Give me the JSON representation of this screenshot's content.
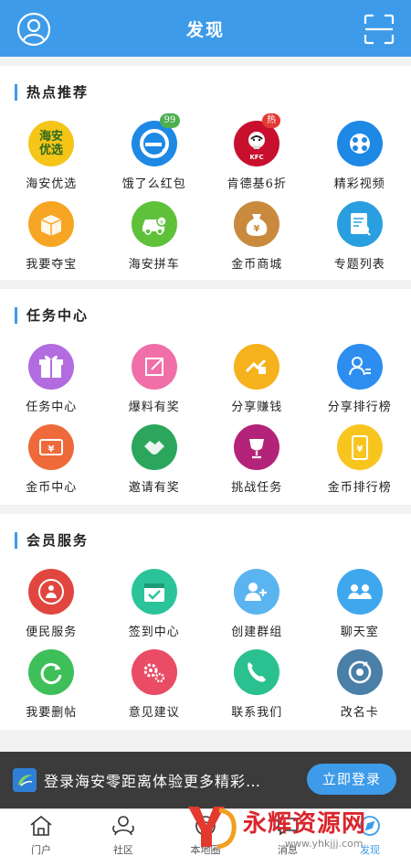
{
  "header": {
    "title": "发现"
  },
  "sections": [
    {
      "title": "热点推荐",
      "items": [
        {
          "label": "海安优选",
          "icon": "haian-youxuan-logo",
          "color": "#f5c518",
          "logo_text": "海安优选"
        },
        {
          "label": "饿了么红包",
          "icon": "eleme-logo",
          "color": "#1e88e5",
          "badge": "99",
          "badge_color": "#4caf50"
        },
        {
          "label": "肯德基6折",
          "icon": "kfc-logo",
          "color": "#c8102e",
          "badge": "热",
          "badge_color": "#e53935"
        },
        {
          "label": "精彩视频",
          "icon": "video-reel-icon",
          "color": "#1e88e5"
        },
        {
          "label": "我要夺宝",
          "icon": "treasure-box-icon",
          "color": "#f6a623"
        },
        {
          "label": "海安拼车",
          "icon": "car-icon",
          "color": "#5fc13a"
        },
        {
          "label": "金币商城",
          "icon": "money-bag-icon",
          "color": "#c98a3e"
        },
        {
          "label": "专题列表",
          "icon": "document-search-icon",
          "color": "#2a9fe0"
        }
      ]
    },
    {
      "title": "任务中心",
      "items": [
        {
          "label": "任务中心",
          "icon": "gift-icon",
          "color": "#b26ce0"
        },
        {
          "label": "爆料有奖",
          "icon": "edit-note-icon",
          "color": "#f06fa8"
        },
        {
          "label": "分享赚钱",
          "icon": "share-hand-icon",
          "color": "#f5b21d"
        },
        {
          "label": "分享排行榜",
          "icon": "user-rank-icon",
          "color": "#2d8ef0"
        },
        {
          "label": "金币中心",
          "icon": "coin-ticket-icon",
          "color": "#ef6a3a"
        },
        {
          "label": "邀请有奖",
          "icon": "handshake-icon",
          "color": "#2ba65c"
        },
        {
          "label": "挑战任务",
          "icon": "trophy-icon",
          "color": "#b4237a"
        },
        {
          "label": "金币排行榜",
          "icon": "phone-coin-icon",
          "color": "#f8c51f"
        }
      ]
    },
    {
      "title": "会员服务",
      "items": [
        {
          "label": "便民服务",
          "icon": "community-service-icon",
          "color": "#e0463f"
        },
        {
          "label": "签到中心",
          "icon": "calendar-check-icon",
          "color": "#2bc49a"
        },
        {
          "label": "创建群组",
          "icon": "create-group-icon",
          "color": "#5ab4f0"
        },
        {
          "label": "聊天室",
          "icon": "chat-room-icon",
          "color": "#3ea7ee"
        },
        {
          "label": "我要删帖",
          "icon": "refresh-icon",
          "color": "#3fbf5a"
        },
        {
          "label": "意见建议",
          "icon": "gears-icon",
          "color": "#e94c64"
        },
        {
          "label": "联系我们",
          "icon": "phone-icon",
          "color": "#2bc08f"
        },
        {
          "label": "改名卡",
          "icon": "rename-card-icon",
          "color": "#4a7fa8"
        }
      ]
    }
  ],
  "login_bar": {
    "text": "登录海安零距离体验更多精彩…",
    "button": "立即登录"
  },
  "tabbar": [
    {
      "label": "门户",
      "icon": "home-icon"
    },
    {
      "label": "社区",
      "icon": "community-icon"
    },
    {
      "label": "本地圈",
      "icon": "local-circle-icon"
    },
    {
      "label": "消息",
      "icon": "message-icon"
    },
    {
      "label": "发现",
      "icon": "discover-icon",
      "active": true
    }
  ],
  "watermark": {
    "text": "永辉资源网",
    "url": "www.yhkjjj.com"
  },
  "colors": {
    "brand": "#3d9be9",
    "login_bar_bg": "#3b3b3b"
  }
}
